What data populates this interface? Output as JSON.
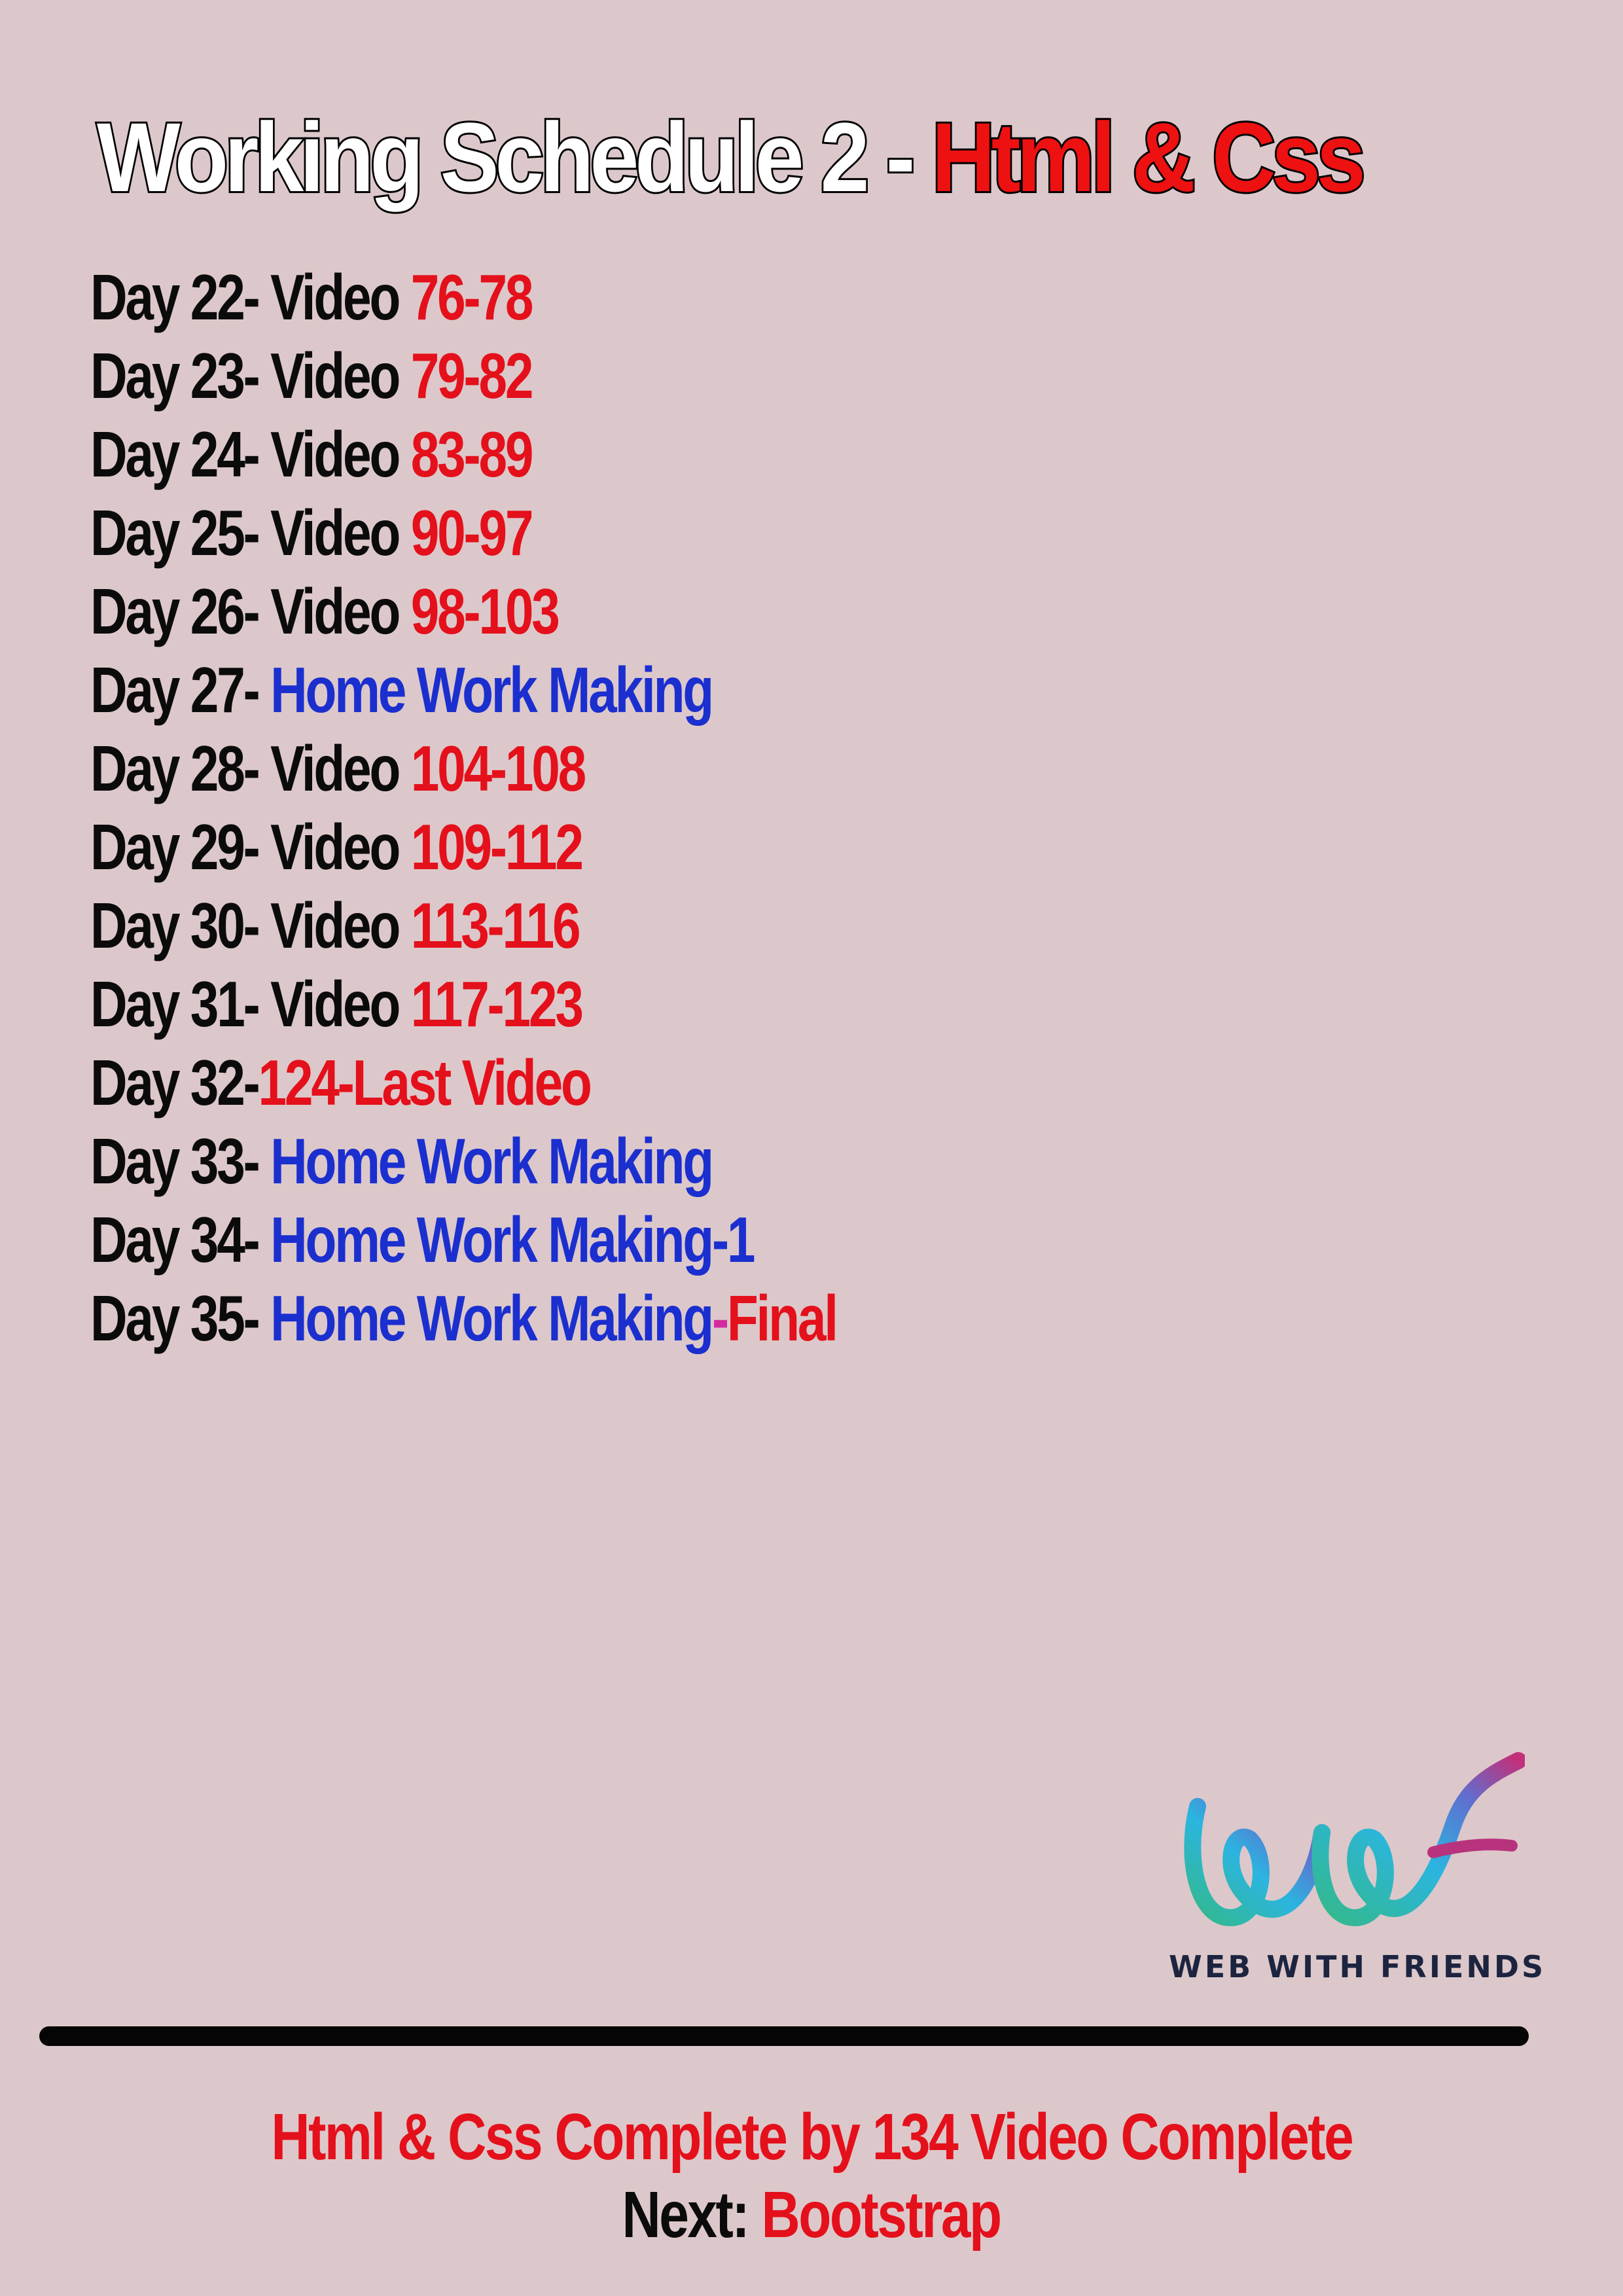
{
  "title": {
    "part1": "Working Schedule  2 - ",
    "part2": "Html & Css"
  },
  "schedule": [
    {
      "day": "Day 22- ",
      "label": "Video ",
      "range": "76-78"
    },
    {
      "day": "Day 23- ",
      "label": "Video ",
      "range": "79-82"
    },
    {
      "day": "Day 24- ",
      "label": "Video ",
      "range": "83-89"
    },
    {
      "day": "Day 25- ",
      "label": "Video ",
      "range": "90-97"
    },
    {
      "day": "Day 26- ",
      "label": "Video ",
      "range": "98-103"
    },
    {
      "day": "Day 27- ",
      "homework": "Home Work Making"
    },
    {
      "day": "Day 28- ",
      "label": "Video ",
      "range": "104-108"
    },
    {
      "day": "Day 29- ",
      "label": " Video ",
      "range": "109-112"
    },
    {
      "day": "Day 30- ",
      "label": "Video ",
      "range": "113-116"
    },
    {
      "day": "Day 31- ",
      "label": "Video  ",
      "range": "117-123"
    },
    {
      "day": "Day 32-",
      "range": "124-Last Video"
    },
    {
      "day": "Day 33- ",
      "homework": "Home Work Making"
    },
    {
      "day": "Day 34- ",
      "homework": "Home Work Making-1"
    },
    {
      "day": "Day 35- ",
      "homework": "Home Work Making",
      "dash": "-",
      "final": "Final"
    }
  ],
  "logo": {
    "icon": "web-with-friends-logo",
    "text": "WEB WITH FRIENDS"
  },
  "footer": {
    "line1": "Html & Css Complete by 134 Video Complete",
    "next_label": "Next: ",
    "next_value": "Bootstrap"
  },
  "colors": {
    "background": "#dcc8ca",
    "red": "#e4101b",
    "blue": "#1b2fcf",
    "black": "#0b0b0b"
  }
}
